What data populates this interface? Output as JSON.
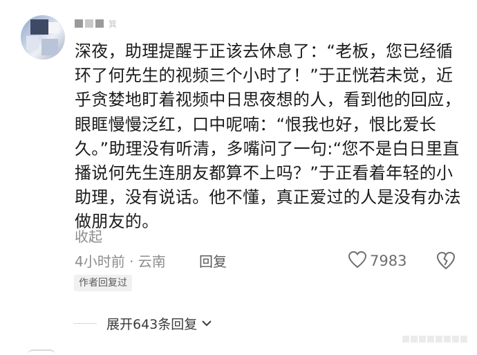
{
  "comment": {
    "username_hint": "箕",
    "text": "深夜，助理提醒于正该去休息了：“老板，您已经循环了何先生的视频三个小时了！”于正恍若未觉，近乎贪婪地盯着视频中日思夜想的人，看到他的回应，眼眶慢慢泛红，口中呢喃：“恨我也好，恨比爱长久。”助理没有听清，多嘴问了一句:“您不是白日里直播说何先生连朋友都算不上吗？”于正看着年轻的小助理，没有说话。他不懂，真正爱过的人是没有办法做朋友的。",
    "collapse_label": "收起",
    "meta": "4小时前 · 云南",
    "reply_label": "回复",
    "like_count": "7983",
    "author_badge": "作者回复过",
    "expand_label": "展开643条回复"
  },
  "icons": {
    "like": "heart-outline-icon",
    "dislike": "broken-heart-icon",
    "expand": "chevron-down-icon"
  },
  "colors": {
    "text": "#1b1b1b",
    "muted": "#8c8c8c",
    "badge_bg": "#f1f1f1"
  }
}
